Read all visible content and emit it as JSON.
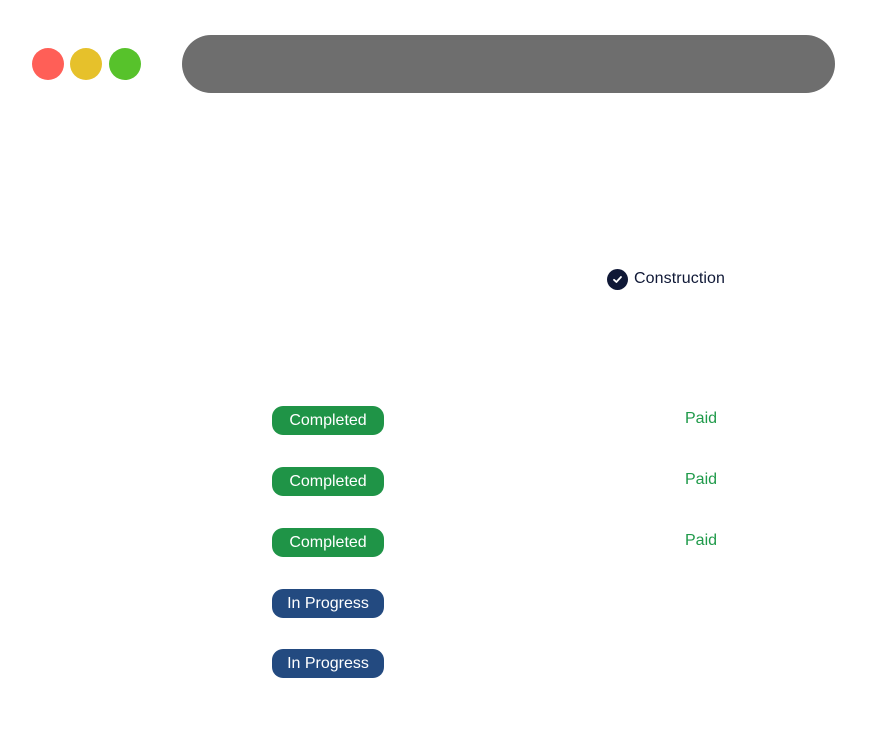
{
  "window": {
    "controls": [
      "close",
      "minimize",
      "maximize"
    ]
  },
  "colors": {
    "completed": "#1f9447",
    "in_progress": "#234a80",
    "paid_text": "#1f9a4a",
    "address_bar": "#6e6e6e"
  },
  "category": {
    "icon": "check-circle-icon",
    "label": "Construction"
  },
  "rows": [
    {
      "status": "Completed",
      "status_type": "completed",
      "payment": "Paid"
    },
    {
      "status": "Completed",
      "status_type": "completed",
      "payment": "Paid"
    },
    {
      "status": "Completed",
      "status_type": "completed",
      "payment": "Paid"
    },
    {
      "status": "In Progress",
      "status_type": "in_progress",
      "payment": ""
    },
    {
      "status": "In Progress",
      "status_type": "in_progress",
      "payment": ""
    }
  ]
}
